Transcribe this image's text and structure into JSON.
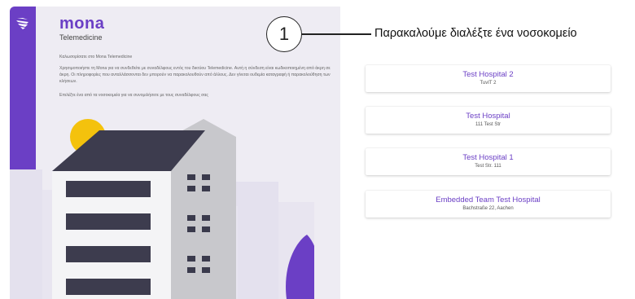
{
  "app": {
    "brand": "mona",
    "subtitle": "Telemedicine",
    "welcome": "Καλωσορίσατε στο Mona Telemedicine",
    "description": "Χρησιμοποιήστε τη Mona για να συνδεθείτε με συναδέλφους εντός του δικτύου Telemedicine. Αυτή η σύνδεση είναι κωδικοποιημένη από άκρη σε άκρη. Οι πληροφορίες που ανταλλάσσονται δεν μπορούν να παρακολουθούν από άλλους. Δεν γίνεται ουδεμία καταγραφή ή παρακολούθηση των κλήσεων.",
    "instruction": "Επιλέξτε ένα από τα νοσοκομεία για να συνομιλήσετε με τους συναδέλφους σας",
    "accent": "#6b3fc5"
  },
  "annotation": {
    "number": "1",
    "text": "Παρακαλούμε διαλέξτε ένα νοσοκομείο"
  },
  "hospitals": [
    {
      "name": "Test Hospital 2",
      "address": "TuvIT 2"
    },
    {
      "name": "Test Hospital",
      "address": "111 Test Str"
    },
    {
      "name": "Test Hospital 1",
      "address": "Test Str. 111"
    },
    {
      "name": "Embedded Team Test Hospital",
      "address": "Bachstraße 22, Aachen"
    }
  ],
  "icons": {
    "logo": "mona-logo-icon",
    "settings": "gear-icon",
    "logout": "logout-icon"
  }
}
